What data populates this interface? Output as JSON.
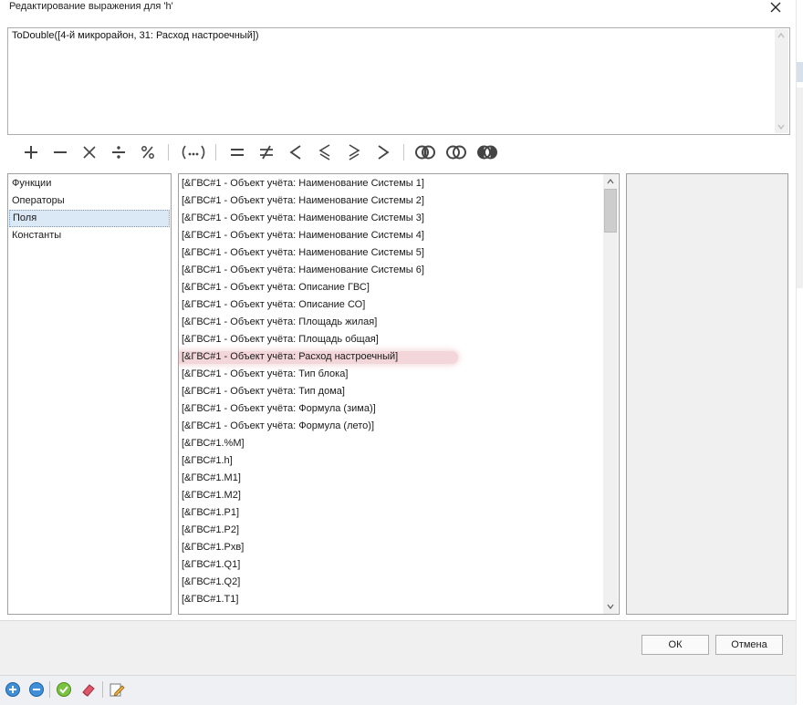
{
  "window": {
    "title": "Редактирование выражения для 'h'"
  },
  "expression": {
    "text": "ToDouble([4-й микрорайон, 31: Расход настроечный])"
  },
  "toolbar": {
    "operators": [
      "plus-icon",
      "minus-icon",
      "multiply-icon",
      "divide-icon",
      "percent-icon",
      "parentheses-icon",
      "equals-icon",
      "not-equal-icon",
      "less-than-icon",
      "less-or-equal-icon",
      "greater-or-equal-icon",
      "greater-than-icon",
      "and-icon",
      "or-icon",
      "not-icon"
    ]
  },
  "categories": {
    "items": [
      "Функции",
      "Операторы",
      "Поля",
      "Константы"
    ],
    "selected": "Поля"
  },
  "fields": {
    "items": [
      "[&ГВС#1 - Объект учёта: Наименование Системы 1]",
      "[&ГВС#1 - Объект учёта: Наименование Системы 2]",
      "[&ГВС#1 - Объект учёта: Наименование Системы 3]",
      "[&ГВС#1 - Объект учёта: Наименование Системы 4]",
      "[&ГВС#1 - Объект учёта: Наименование Системы 5]",
      "[&ГВС#1 - Объект учёта: Наименование Системы 6]",
      "[&ГВС#1 - Объект учёта: Описание ГВС]",
      "[&ГВС#1 - Объект учёта: Описание СО]",
      "[&ГВС#1 - Объект учёта: Площадь жилая]",
      "[&ГВС#1 - Объект учёта: Площадь общая]",
      "[&ГВС#1 - Объект учёта: Расход настроечный]",
      "[&ГВС#1 - Объект учёта: Тип блока]",
      "[&ГВС#1 - Объект учёта: Тип дома]",
      "[&ГВС#1 - Объект учёта: Формула (зима)]",
      "[&ГВС#1 - Объект учёта: Формула (лето)]",
      "[&ГВС#1.%M]",
      "[&ГВС#1.h]",
      "[&ГВС#1.M1]",
      "[&ГВС#1.M2]",
      "[&ГВС#1.P1]",
      "[&ГВС#1.P2]",
      "[&ГВС#1.Pхв]",
      "[&ГВС#1.Q1]",
      "[&ГВС#1.Q2]",
      "[&ГВС#1.T1]"
    ],
    "highlighted": "[&ГВС#1 - Объект учёта: Расход настроечный]"
  },
  "buttons": {
    "ok": "ОК",
    "cancel": "Отмена"
  },
  "bottom_toolbar": {
    "icons": [
      "add-icon",
      "remove-icon",
      "check-icon",
      "eraser-icon",
      "edit-icon"
    ]
  },
  "colors": {
    "selection": "#dbe8f6",
    "highlight": "#e8a0a8",
    "accent": "#2e7bc4"
  }
}
